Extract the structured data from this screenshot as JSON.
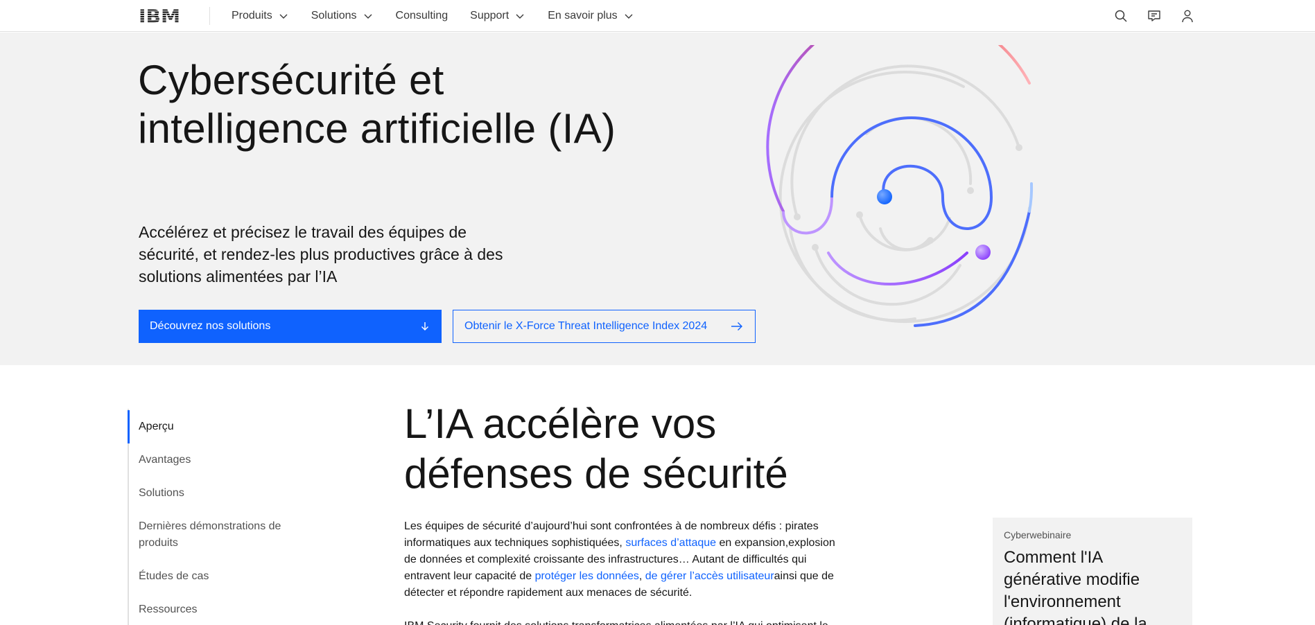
{
  "nav": {
    "logo_text": "IBM",
    "items": [
      {
        "label": "Produits",
        "has_dropdown": true
      },
      {
        "label": "Solutions",
        "has_dropdown": true
      },
      {
        "label": "Consulting",
        "has_dropdown": false
      },
      {
        "label": "Support",
        "has_dropdown": true
      },
      {
        "label": "En savoir plus",
        "has_dropdown": true
      }
    ],
    "icons": [
      "search-icon",
      "chat-icon",
      "user-icon"
    ]
  },
  "hero": {
    "title_line1": "Cybersécurité et",
    "title_line2": "intelligence artificielle (IA)",
    "subtitle": "Accélérez et précisez le travail des équipes de sécurité, et rendez-les plus productives grâce à des solutions alimentées par l’IA",
    "primary_button": "Découvrez nos solutions",
    "secondary_button": "Obtenir le X-Force Threat Intelligence Index 2024"
  },
  "sidenav": {
    "items": [
      {
        "label": "Aperçu",
        "active": true
      },
      {
        "label": "Avantages",
        "active": false
      },
      {
        "label": "Solutions",
        "active": false
      },
      {
        "label": "Dernières démonstrations de produits",
        "active": false
      },
      {
        "label": "Études de cas",
        "active": false
      },
      {
        "label": "Ressources",
        "active": false
      }
    ]
  },
  "main": {
    "title_line1": "L’IA accélère vos",
    "title_line2": "défenses de sécurité",
    "p1": {
      "t1": "Les équipes de sécurité d’aujourd’hui sont confrontées à de nombreux défis : pirates informatiques aux techniques sophistiquées, ",
      "link1": "surfaces d’attaque",
      "t2": " en expansion,explosion de données et complexité croissante des infrastructures… Autant de difficultés qui entravent leur capacité de ",
      "link2": "protéger les données",
      "t3": ", ",
      "link3": "de gérer l’accès utilisateur",
      "t4": "ainsi que de détecter et répondre rapidement aux menaces de sécurité."
    },
    "p2": "IBM Security fournit des solutions transformatrices alimentées par l’IA qui optimisent le"
  },
  "card": {
    "eyebrow": "Cyberwebinaire",
    "title": "Comment l'IA générative modifie l'environnement (informatique) de la"
  },
  "colors": {
    "accent": "#0f62fe",
    "hero_bg": "#f2f2f2",
    "text": "#161616"
  }
}
